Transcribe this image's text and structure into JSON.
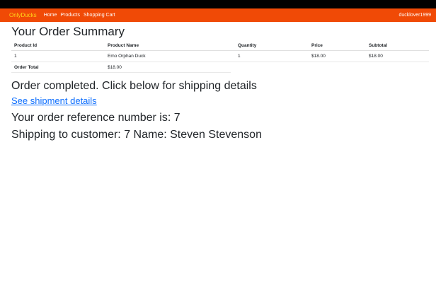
{
  "navbar": {
    "brand": "OnlyDucks",
    "links": [
      "Home",
      "Products",
      "Shopping Cart"
    ],
    "user": "ducklover1999",
    "color": "#f04a06",
    "brand_color": "#ffd21a"
  },
  "summary": {
    "title": "Your Order Summary",
    "headers": [
      "Product Id",
      "Product Name",
      "Quantity",
      "Price",
      "Subtotal"
    ],
    "rows": [
      [
        "1",
        "Emo Orphan Duck",
        "1",
        "$18.00",
        "$18.00"
      ]
    ],
    "total_label": "Order Total",
    "total_value": "$18.00"
  },
  "status": {
    "message": "Order completed. Click below for shipping details",
    "link_text": "See shipment details",
    "reference": "Your order reference number is: 7",
    "shipping": "Shipping to customer: 7 Name: Steven Stevenson"
  }
}
